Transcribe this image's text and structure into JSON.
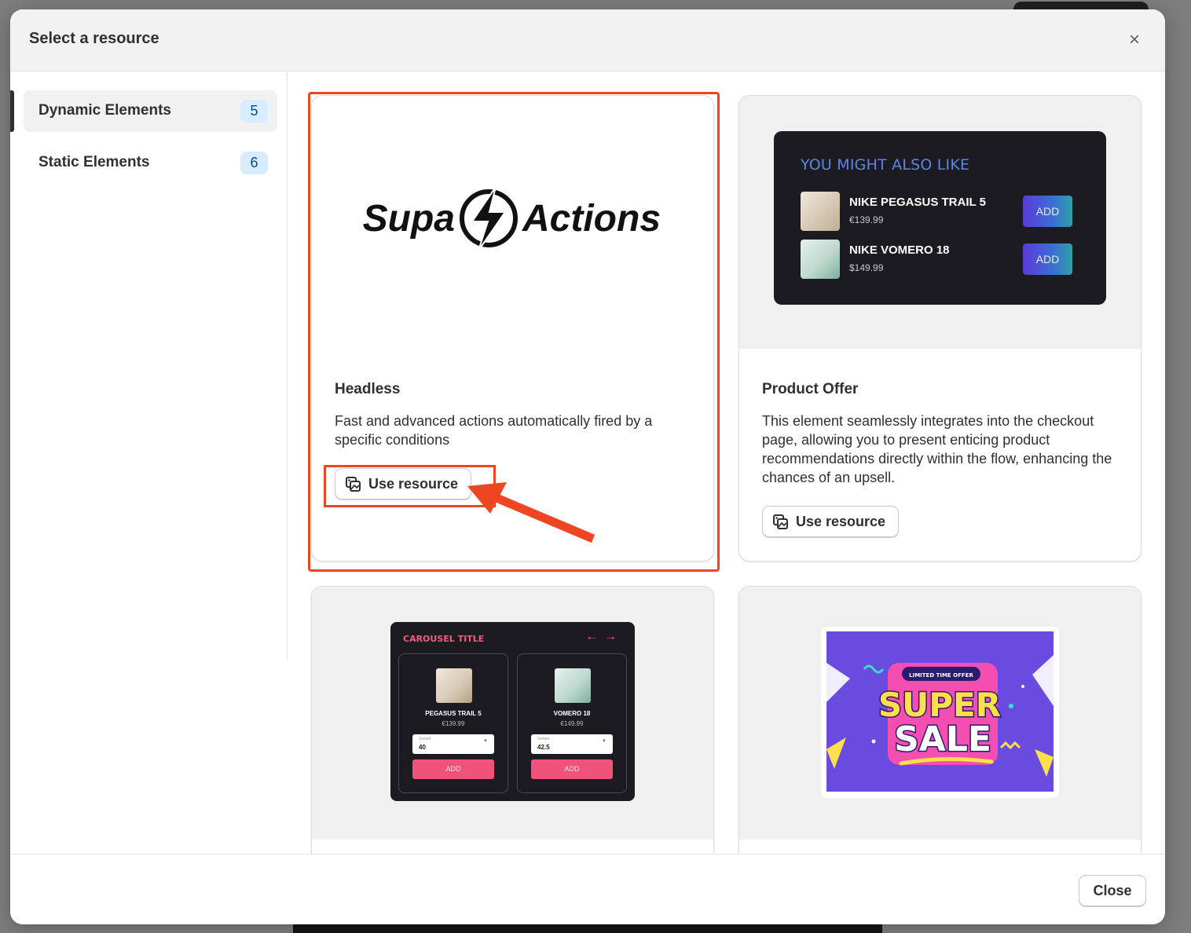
{
  "modal": {
    "title": "Select a resource",
    "close_icon": "close-icon",
    "footer_close_label": "Close"
  },
  "sidebar": {
    "items": [
      {
        "label": "Dynamic Elements",
        "count": "5",
        "active": true
      },
      {
        "label": "Static Elements",
        "count": "6",
        "active": false
      }
    ]
  },
  "cards": [
    {
      "title": "Headless",
      "description": "Fast and advanced actions automatically fired by a specific conditions",
      "button_label": "Use resource",
      "preview": {
        "logo_left": "Supa",
        "logo_right": "Actions"
      }
    },
    {
      "title": "Product Offer",
      "description": "This element seamlessly integrates into the checkout page, allowing you to present enticing product recommendations directly within the flow, enhancing the chances of an upsell.",
      "button_label": "Use resource",
      "preview": {
        "heading": "YOU MIGHT ALSO LIKE",
        "products": [
          {
            "name": "NIKE PEGASUS TRAIL 5",
            "price": "€139.99",
            "button": "ADD"
          },
          {
            "name": "NIKE VOMERO 18",
            "price": "$149.99",
            "button": "ADD"
          }
        ]
      }
    },
    {
      "preview": {
        "title": "CAROUSEL TITLE",
        "arrows": "←→",
        "products": [
          {
            "name": "PEGASUS TRAIL 5",
            "price": "€139.99",
            "variant_label": "Variant",
            "variant_value": "40",
            "button": "ADD"
          },
          {
            "name": "VOMERO 18",
            "price": "€149.99",
            "variant_label": "Variant",
            "variant_value": "42.5",
            "button": "ADD"
          }
        ]
      }
    },
    {
      "preview": {
        "badge": "LIMITED TIME OFFER",
        "line1": "SUPER",
        "line2": "SALE"
      }
    }
  ],
  "colors": {
    "highlight": "#ee4623",
    "badge_bg": "#d8ecff",
    "sale_purple": "#6a4be0",
    "carousel_accent": "#f0537a"
  }
}
